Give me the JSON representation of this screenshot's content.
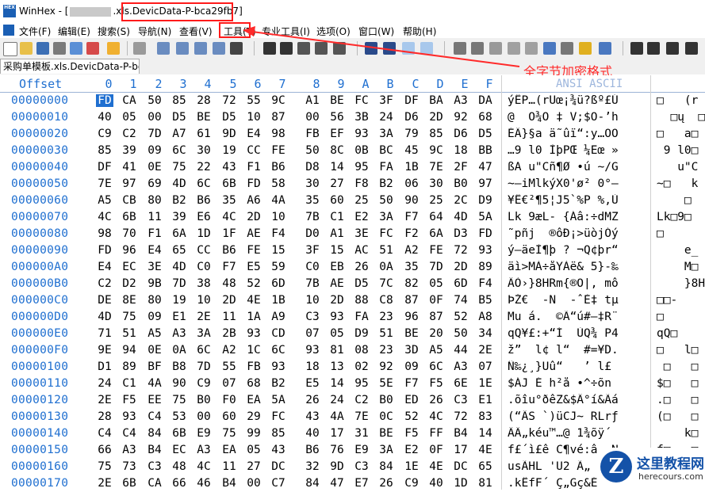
{
  "window": {
    "app_title_prefix": "WinHex - [",
    "file_name_visible": ".xls.",
    "title_highlighted": "DevicData-P-bca29fb7]"
  },
  "menu": [
    {
      "label": "文件(F)"
    },
    {
      "label": "编辑(E)"
    },
    {
      "label": "搜索(S)"
    },
    {
      "label": "导航(N)"
    },
    {
      "label": "查看(V)"
    },
    {
      "label": "工具(T)"
    },
    {
      "label": "专业工具(I)"
    },
    {
      "label": "选项(O)"
    },
    {
      "label": "窗口(W)"
    },
    {
      "label": "帮助(H)"
    }
  ],
  "tab": {
    "label": "采购单模板.xls.DevicData-P-bc..."
  },
  "annotation": "全字节加密格式",
  "header": {
    "offset_label": "Offset",
    "columns": [
      "0",
      "1",
      "2",
      "3",
      "4",
      "5",
      "6",
      "7",
      "8",
      "9",
      "A",
      "B",
      "C",
      "D",
      "E",
      "F"
    ],
    "ansi_label": "ANSI ASCII"
  },
  "rows": [
    {
      "offset": "00000000",
      "bytes": [
        "FD",
        "CA",
        "50",
        "85",
        "28",
        "72",
        "55",
        "9C",
        "A1",
        "BE",
        "FC",
        "3F",
        "DF",
        "BA",
        "A3",
        "DA"
      ],
      "ansi": "ýÊP…(rUœ¡¾ü?ßº£Ú",
      "ansi2": "□   (r"
    },
    {
      "offset": "00000010",
      "bytes": [
        "40",
        "05",
        "00",
        "D5",
        "BE",
        "D5",
        "10",
        "87",
        "00",
        "56",
        "3B",
        "24",
        "D6",
        "2D",
        "92",
        "68"
      ],
      "ansi": "@  Õ¾Õ ‡ V;$Ö-’h",
      "ansi2": "  □ų  □"
    },
    {
      "offset": "00000020",
      "bytes": [
        "C9",
        "C2",
        "7D",
        "A7",
        "61",
        "9D",
        "E4",
        "98",
        "FB",
        "EF",
        "93",
        "3A",
        "79",
        "85",
        "D6",
        "D5"
      ],
      "ansi": "ÉÂ}§a ä˜ûï“:y…ÖÕ",
      "ansi2": "□   a□"
    },
    {
      "offset": "00000030",
      "bytes": [
        "85",
        "39",
        "09",
        "6C",
        "30",
        "19",
        "CC",
        "FE",
        "50",
        "8C",
        "0B",
        "BC",
        "45",
        "9C",
        "18",
        "BB"
      ],
      "ansi": "…9 l0 ÌþPŒ ¼Eœ »",
      "ansi2": " 9 l0□"
    },
    {
      "offset": "00000040",
      "bytes": [
        "DF",
        "41",
        "0E",
        "75",
        "22",
        "43",
        "F1",
        "B6",
        "D8",
        "14",
        "95",
        "FA",
        "1B",
        "7E",
        "2F",
        "47"
      ],
      "ansi": "ßA u\"Cñ¶Ø •ú ~/G",
      "ansi2": "   u\"C"
    },
    {
      "offset": "00000050",
      "bytes": [
        "7E",
        "97",
        "69",
        "4D",
        "6C",
        "6B",
        "FD",
        "58",
        "30",
        "27",
        "F8",
        "B2",
        "06",
        "30",
        "B0",
        "97"
      ],
      "ansi": "~—iMlkýX0'ø² 0°—",
      "ansi2": "~□   k"
    },
    {
      "offset": "00000060",
      "bytes": [
        "A5",
        "CB",
        "80",
        "B2",
        "B6",
        "35",
        "A6",
        "4A",
        "35",
        "60",
        "25",
        "50",
        "90",
        "25",
        "2C",
        "D9"
      ],
      "ansi": "¥Ë€²¶5¦J5`%P %,Ù",
      "ansi2": "    □"
    },
    {
      "offset": "00000070",
      "bytes": [
        "4C",
        "6B",
        "11",
        "39",
        "E6",
        "4C",
        "2D",
        "10",
        "7B",
        "C1",
        "E2",
        "3A",
        "F7",
        "64",
        "4D",
        "5A"
      ],
      "ansi": "Lk 9æL- {Áâ:÷dMZ",
      "ansi2": "Lk□9□"
    },
    {
      "offset": "00000080",
      "bytes": [
        "98",
        "70",
        "F1",
        "6A",
        "1D",
        "1F",
        "AE",
        "F4",
        "D0",
        "A1",
        "3E",
        "FC",
        "F2",
        "6A",
        "D3",
        "FD"
      ],
      "ansi": "˜pñj  ®ôÐ¡>üòjÓý",
      "ansi2": "□"
    },
    {
      "offset": "00000090",
      "bytes": [
        "FD",
        "96",
        "E4",
        "65",
        "CC",
        "B6",
        "FE",
        "15",
        "3F",
        "15",
        "AC",
        "51",
        "A2",
        "FE",
        "72",
        "93"
      ],
      "ansi": "ý–äeÌ¶þ ? ¬Q¢þr“",
      "ansi2": "    e_"
    },
    {
      "offset": "000000A0",
      "bytes": [
        "E4",
        "EC",
        "3E",
        "4D",
        "C0",
        "F7",
        "E5",
        "59",
        "C0",
        "EB",
        "26",
        "0A",
        "35",
        "7D",
        "2D",
        "89"
      ],
      "ansi": "äì>MÀ÷åYÀë& 5}-‰",
      "ansi2": "    M□"
    },
    {
      "offset": "000000B0",
      "bytes": [
        "C2",
        "D2",
        "9B",
        "7D",
        "38",
        "48",
        "52",
        "6D",
        "7B",
        "AE",
        "D5",
        "7C",
        "82",
        "05",
        "6D",
        "F4"
      ],
      "ansi": "ÂÒ›}8HRm{®Õ|‚ mô",
      "ansi2": "    }8H"
    },
    {
      "offset": "000000C0",
      "bytes": [
        "DE",
        "8E",
        "80",
        "19",
        "10",
        "2D",
        "4E",
        "1B",
        "10",
        "2D",
        "88",
        "C8",
        "87",
        "0F",
        "74",
        "B5"
      ],
      "ansi": "ÞŽ€  -N  -ˆÈ‡ tµ",
      "ansi2": "□□-"
    },
    {
      "offset": "000000D0",
      "bytes": [
        "4D",
        "75",
        "09",
        "E1",
        "2E",
        "11",
        "1A",
        "A9",
        "C3",
        "93",
        "FA",
        "23",
        "96",
        "87",
        "52",
        "A8"
      ],
      "ansi": "Mu á.  ©Ã“ú#–‡R¨",
      "ansi2": "□"
    },
    {
      "offset": "000000E0",
      "bytes": [
        "71",
        "51",
        "A5",
        "A3",
        "3A",
        "2B",
        "93",
        "CD",
        "07",
        "05",
        "D9",
        "51",
        "BE",
        "20",
        "50",
        "34"
      ],
      "ansi": "qQ¥£:+“Í  ÙQ¾ P4",
      "ansi2": "qQ□"
    },
    {
      "offset": "000000F0",
      "bytes": [
        "9E",
        "94",
        "0E",
        "0A",
        "6C",
        "A2",
        "1C",
        "6C",
        "93",
        "81",
        "08",
        "23",
        "3D",
        "A5",
        "44",
        "2E"
      ],
      "ansi": "ž”  l¢ l“  #=¥D.",
      "ansi2": "□   l□"
    },
    {
      "offset": "00000100",
      "bytes": [
        "D1",
        "89",
        "BF",
        "B8",
        "7D",
        "55",
        "FB",
        "93",
        "18",
        "13",
        "02",
        "92",
        "09",
        "6C",
        "A3",
        "07"
      ],
      "ansi": "Ñ‰¿¸}Uû“   ’ l£ ",
      "ansi2": " □   □"
    },
    {
      "offset": "00000110",
      "bytes": [
        "24",
        "C1",
        "4A",
        "90",
        "C9",
        "07",
        "68",
        "B2",
        "E5",
        "14",
        "95",
        "5E",
        "F7",
        "F5",
        "6E",
        "1E"
      ],
      "ansi": "$ÁJ É h²å •^÷õn ",
      "ansi2": "$□   □"
    },
    {
      "offset": "00000120",
      "bytes": [
        "2E",
        "F5",
        "EE",
        "75",
        "B0",
        "F0",
        "EA",
        "5A",
        "26",
        "24",
        "C2",
        "B0",
        "ED",
        "26",
        "C3",
        "E1"
      ],
      "ansi": ".õîu°ðêZ&$Â°í&Ãá",
      "ansi2": ".□   □"
    },
    {
      "offset": "00000130",
      "bytes": [
        "28",
        "93",
        "C4",
        "53",
        "00",
        "60",
        "29",
        "FC",
        "43",
        "4A",
        "7E",
        "0C",
        "52",
        "4C",
        "72",
        "83"
      ],
      "ansi": "(“ÄS `)üCJ~ RLrƒ",
      "ansi2": "(□   □"
    },
    {
      "offset": "00000140",
      "bytes": [
        "C4",
        "C4",
        "84",
        "6B",
        "E9",
        "75",
        "99",
        "85",
        "40",
        "17",
        "31",
        "BE",
        "F5",
        "FF",
        "B4",
        "14"
      ],
      "ansi": "ÄÄ„kéu™…@ 1¾õÿ´ ",
      "ansi2": "    k□"
    },
    {
      "offset": "00000150",
      "bytes": [
        "66",
        "A3",
        "B4",
        "EC",
        "A3",
        "EA",
        "05",
        "43",
        "B6",
        "76",
        "E9",
        "3A",
        "E2",
        "0F",
        "17",
        "4E"
      ],
      "ansi": "f£´ì£ê C¶vé:â  N",
      "ansi2": "f□   □"
    },
    {
      "offset": "00000160",
      "bytes": [
        "75",
        "73",
        "C3",
        "48",
        "4C",
        "11",
        "27",
        "DC",
        "32",
        "9D",
        "C3",
        "84",
        "1E",
        "4E",
        "DC",
        "65"
      ],
      "ansi": "usÃHL 'Ü2 Ã„ NÜe",
      "ansi2": "□"
    },
    {
      "offset": "00000170",
      "bytes": [
        "2E",
        "6B",
        "CA",
        "66",
        "46",
        "B4",
        "00",
        "C7",
        "84",
        "47",
        "E7",
        "26",
        "C9",
        "40",
        "1D",
        "81"
      ],
      "ansi": ".kÊfF´ Ç„Gç&É@  ",
      "ansi2": ""
    }
  ],
  "watermark": {
    "cn": "这里教程网",
    "url": "herecours.com",
    "logo": "Z"
  }
}
